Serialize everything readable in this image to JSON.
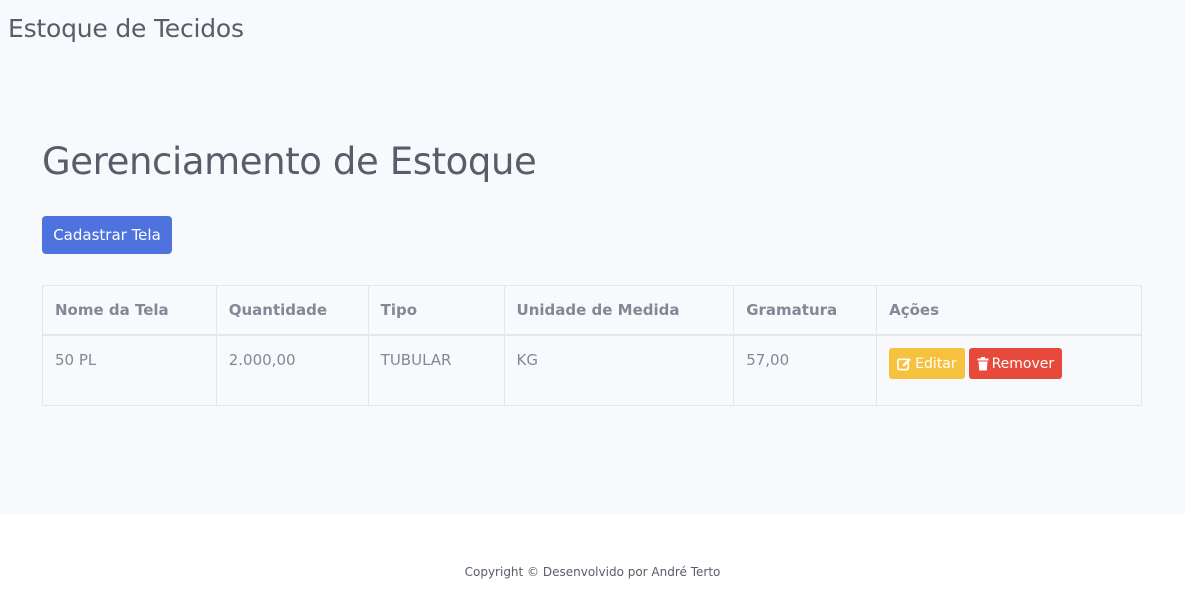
{
  "navbar": {
    "brand": "Estoque de Tecidos"
  },
  "page": {
    "title": "Gerenciamento de Estoque",
    "add_button_label": "Cadastrar Tela"
  },
  "table": {
    "headers": [
      "Nome da Tela",
      "Quantidade",
      "Tipo",
      "Unidade de Medida",
      "Gramatura",
      "Ações"
    ],
    "rows": [
      {
        "nome": "50 PL",
        "quantidade": "2.000,00",
        "tipo": "TUBULAR",
        "unidade": "KG",
        "gramatura": "57,00",
        "edit_label": "Editar",
        "remove_label": "Remover"
      }
    ]
  },
  "footer": {
    "text": "Copyright © Desenvolvido por André Terto"
  },
  "colors": {
    "primary": "#4e73df",
    "warning": "#f6c23e",
    "danger": "#e74a3b",
    "background": "#f8f9fc"
  }
}
